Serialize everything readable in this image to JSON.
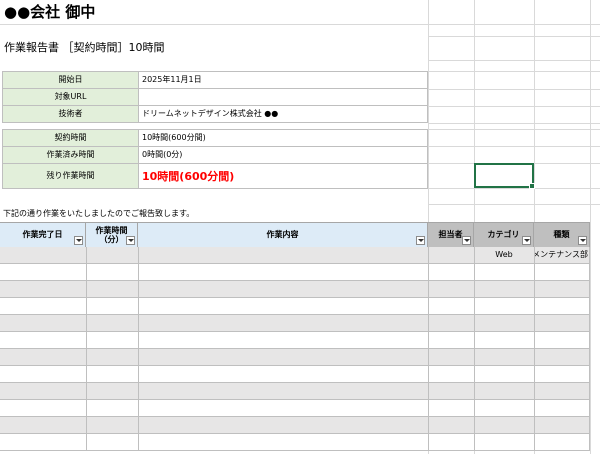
{
  "title": "●●会社 御中",
  "subtitle": "作業報告書 ［契約時間］10時間",
  "info": {
    "start_label": "開始日",
    "start_value": "2025年11月1日",
    "url_label": "対象URL",
    "url_value": "",
    "engineer_label": "技術者",
    "engineer_value": "ドリームネットデザイン株式会社 ●●",
    "contract_label": "契約時間",
    "contract_value": "10時間(600分間)",
    "done_label": "作業済み時間",
    "done_value": "0時間(0分)",
    "remain_label": "残り作業時間",
    "remain_value": "10時間(600分間)"
  },
  "colors": {
    "remain_text": "#ff0000",
    "label_bg": "#e2efda",
    "header_blue": "#ddebf7",
    "header_gray": "#bfbfbf",
    "selection": "#217346"
  },
  "note": "下記の通り作業をいたしましたのでご報告致します。",
  "table": {
    "headers": [
      "作業完了日",
      "作業時間\n（分）",
      "作業内容",
      "担当者",
      "カテゴリ",
      "種類"
    ],
    "rows": [
      [
        "",
        "",
        "",
        "",
        "Web",
        "メンテナンス部"
      ],
      [
        "",
        "",
        "",
        "",
        "",
        ""
      ],
      [
        "",
        "",
        "",
        "",
        "",
        ""
      ],
      [
        "",
        "",
        "",
        "",
        "",
        ""
      ],
      [
        "",
        "",
        "",
        "",
        "",
        ""
      ],
      [
        "",
        "",
        "",
        "",
        "",
        ""
      ],
      [
        "",
        "",
        "",
        "",
        "",
        ""
      ],
      [
        "",
        "",
        "",
        "",
        "",
        ""
      ],
      [
        "",
        "",
        "",
        "",
        "",
        ""
      ],
      [
        "",
        "",
        "",
        "",
        "",
        ""
      ],
      [
        "",
        "",
        "",
        "",
        "",
        ""
      ],
      [
        "",
        "",
        "",
        "",
        "",
        ""
      ]
    ]
  }
}
